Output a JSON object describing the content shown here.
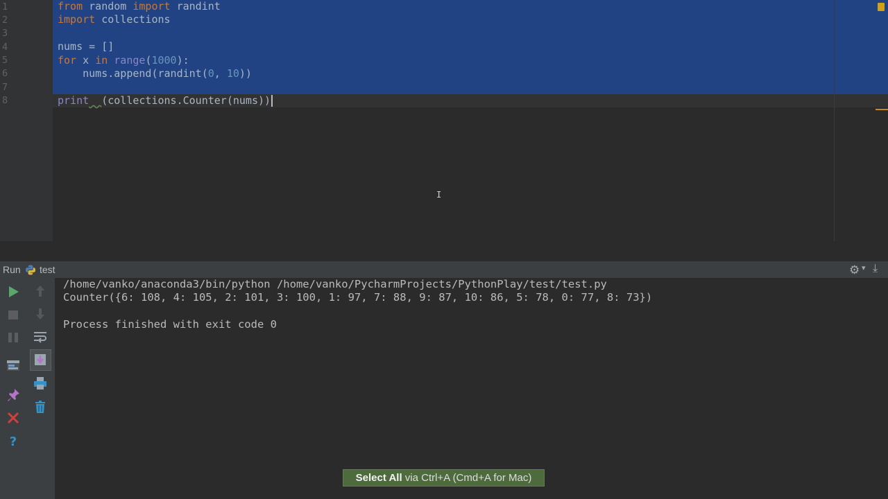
{
  "editor": {
    "line_numbers": [
      "1",
      "2",
      "3",
      "4",
      "5",
      "6",
      "7",
      "8"
    ],
    "code": {
      "l1": {
        "kw1": "from",
        "t1": " random ",
        "kw2": "import",
        "t2": " randint"
      },
      "l2": {
        "kw1": "import",
        "t1": " collections"
      },
      "l3": {},
      "l4": {
        "t1": "nums = []"
      },
      "l5": {
        "kw1": "for",
        "t1": " x ",
        "kw2": "in",
        "t2": " ",
        "b1": "range",
        "t3": "(",
        "n1": "1000",
        "t4": "):"
      },
      "l6": {
        "t1": "    nums.append(randint(",
        "n1": "0",
        "t2": ", ",
        "n2": "10",
        "t3": "))"
      },
      "l7": {},
      "l8": {
        "b1": "print",
        "t1": "  ",
        "t2": "(collections.Counter(nums))"
      }
    }
  },
  "run_panel": {
    "label": "Run",
    "tab_name": "test",
    "console": [
      "/home/vanko/anaconda3/bin/python /home/vanko/PycharmProjects/PythonPlay/test/test.py",
      "Counter({6: 108, 4: 105, 2: 101, 3: 100, 1: 97, 7: 88, 9: 87, 10: 86, 5: 78, 0: 77, 8: 73})",
      "",
      "Process finished with exit code 0"
    ],
    "icons": {
      "run": "run-icon",
      "stop": "stop-icon",
      "pause": "pause-icon",
      "up": "arrow-up-icon",
      "down": "arrow-down-icon",
      "wrap": "soft-wrap-icon",
      "scroll": "scroll-to-end-icon",
      "print": "print-icon",
      "trash": "trash-icon",
      "layout": "restore-layout-icon",
      "pin": "pin-icon",
      "close": "close-icon",
      "help": "help-icon"
    }
  },
  "tooltip": {
    "bold": "Select All",
    "rest": " via Ctrl+A (Cmd+A for Mac)"
  },
  "colors": {
    "editor_bg": "#2b2b2b",
    "selection": "#214283",
    "keyword": "#cc7832",
    "number": "#6897bb",
    "builtin": "#8888c6",
    "run_green": "#59a869",
    "close_red": "#d13f3f",
    "help_blue": "#3592c4",
    "tip_bg": "#4d6b3c"
  }
}
